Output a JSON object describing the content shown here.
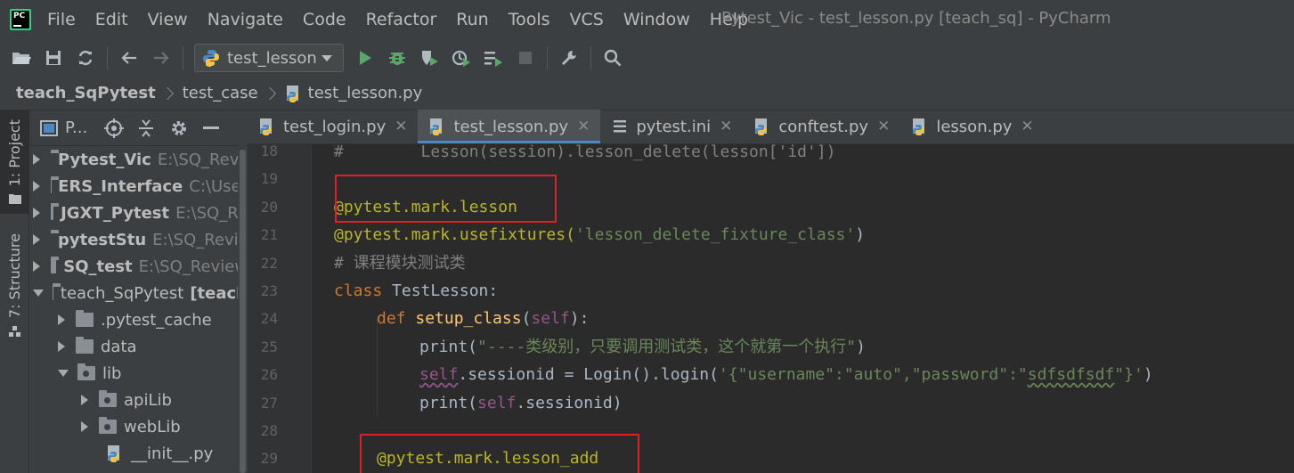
{
  "menubar": {
    "logo_text": "PC",
    "items": [
      "File",
      "Edit",
      "View",
      "Navigate",
      "Code",
      "Refactor",
      "Run",
      "Tools",
      "VCS",
      "Window",
      "Help"
    ],
    "window_title": "Pytest_Vic - test_lesson.py [teach_sq] - PyCharm"
  },
  "toolbar": {
    "run_config": "test_lesson",
    "icons": [
      "open-folder-icon",
      "save-icon",
      "sync-icon",
      "back-icon",
      "forward-icon",
      "run-icon",
      "debug-icon",
      "coverage-icon",
      "profile-icon",
      "concurrency-icon",
      "stop-icon",
      "settings-wrench-icon",
      "search-icon"
    ]
  },
  "breadcrumb": [
    "teach_SqPytest",
    "test_case",
    "test_lesson.py"
  ],
  "left_strip": {
    "project_tab": "1: Project",
    "structure_tab": "7: Structure"
  },
  "project_panel": {
    "title": "P...",
    "tree": [
      {
        "name": "Pytest_Vic",
        "path": "E:\\SQ_Revie",
        "bold": true,
        "level": 0,
        "expanded": false
      },
      {
        "name": "ERS_Interface",
        "path": "C:\\User",
        "bold": true,
        "level": 0,
        "expanded": false
      },
      {
        "name": "JGXT_Pytest",
        "path": "E:\\SQ_Re",
        "bold": true,
        "level": 0,
        "expanded": false
      },
      {
        "name": "pytestStu",
        "path": "E:\\SQ_Revie",
        "bold": true,
        "level": 0,
        "expanded": false
      },
      {
        "name": "SQ_test",
        "path": "E:\\SQ_Review",
        "bold": true,
        "level": 0,
        "expanded": false
      },
      {
        "name": "teach_SqPytest",
        "path": "[teach",
        "bold": false,
        "level": 0,
        "expanded": true
      },
      {
        "name": ".pytest_cache",
        "path": "",
        "bold": false,
        "level": 1,
        "expanded": false
      },
      {
        "name": "data",
        "path": "",
        "bold": false,
        "level": 1,
        "expanded": false
      },
      {
        "name": "lib",
        "path": "",
        "bold": false,
        "level": 1,
        "expanded": true
      },
      {
        "name": "apiLib",
        "path": "",
        "bold": false,
        "level": 2,
        "expanded": false
      },
      {
        "name": "webLib",
        "path": "",
        "bold": false,
        "level": 2,
        "expanded": false
      },
      {
        "name": "__init__.py",
        "path": "",
        "bold": false,
        "level": 2,
        "file": true
      }
    ]
  },
  "tabs": [
    {
      "label": "test_login.py",
      "active": false
    },
    {
      "label": "test_lesson.py",
      "active": true
    },
    {
      "label": "pytest.ini",
      "active": false
    },
    {
      "label": "conftest.py",
      "active": false
    },
    {
      "label": "lesson.py",
      "active": false
    }
  ],
  "editor": {
    "line_numbers": [
      "18",
      "19",
      "20",
      "21",
      "22",
      "23",
      "24",
      "25",
      "26",
      "27",
      "28",
      "29"
    ],
    "code": {
      "l18a": "#",
      "l18b": "        Lesson(session).lesson_delete(lesson['id'])",
      "l20": "@pytest.mark.lesson",
      "l21a": "@pytest.mark.usefixtures(",
      "l21b": "'lesson_delete_fixture_class'",
      "l21c": ")",
      "l22": "# 课程模块测试类",
      "l23a": "class",
      "l23b": " TestLesson:",
      "l24a": "def ",
      "l24b": "setup_class",
      "l24c": "(",
      "l24d": "self",
      "l24e": "):",
      "l25a": "print(",
      "l25b": "\"----类级别，只要调用测试类，这个就第一个执行\"",
      "l25c": ")",
      "l26a": "self",
      "l26b": ".sessionid = Login().login(",
      "l26c": "'{\"username\":\"auto\",\"password\":\"",
      "l26d": "sdfsdfsdf",
      "l26e": "\"}'",
      "l26f": ")",
      "l27a": "print(",
      "l27b": "self",
      "l27c": ".sessionid)",
      "l29": "@pytest.mark.lesson_add"
    }
  },
  "colors": {
    "highlight_box": "#e02020",
    "decorator": "#bbb529",
    "keyword": "#cc7832",
    "string": "#6a8759"
  }
}
